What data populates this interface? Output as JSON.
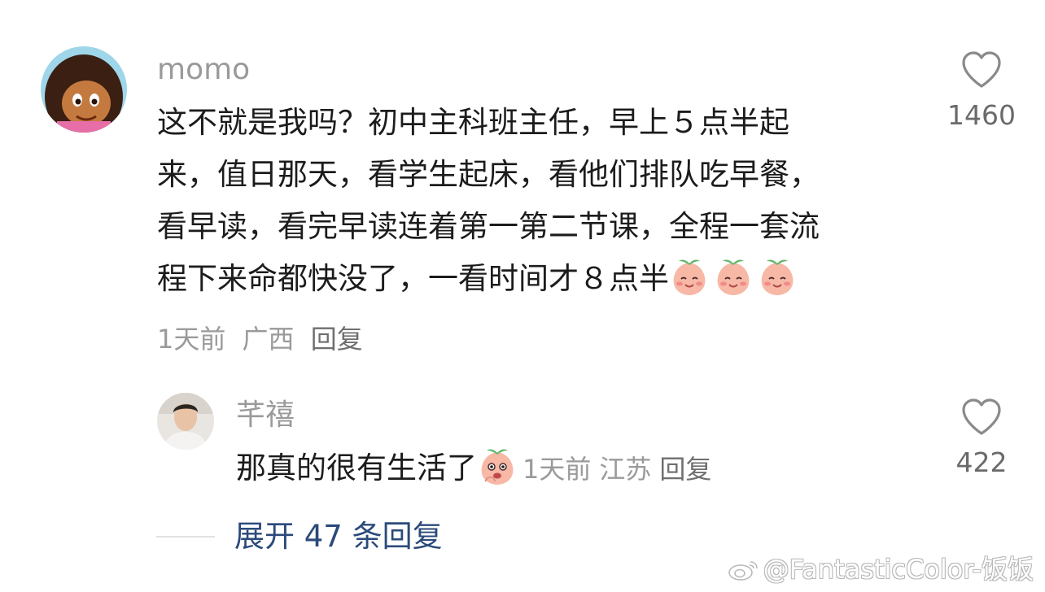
{
  "comment": {
    "username": "momo",
    "content_lines": [
      "这不就是我吗？初中主科班主任，早上５点半起",
      "来，值日那天，看学生起床，看他们排队吃早餐，",
      "看早读，看完早读连着第一第二节课，全程一套流",
      "程下来命都快没了，一看时间才８点半"
    ],
    "emojis": [
      "peach-smile-emoji",
      "peach-smile-emoji",
      "peach-smile-emoji"
    ],
    "time": "1天前",
    "location": "广西",
    "reply_label": "回复",
    "like_count": "1460",
    "avatar_icon": "cartoon-girl-avatar"
  },
  "reply": {
    "username": "芊禧",
    "content": "那真的很有生活了",
    "emoji": "peach-thinking-emoji",
    "time": "1天前",
    "location": "江苏",
    "reply_label": "回复",
    "like_count": "422",
    "avatar_icon": "man-photo-avatar"
  },
  "expand_label": "展开 47 条回复",
  "watermark": "@FantasticColor-饭饭",
  "colors": {
    "username": "#9a9a9a",
    "text": "#1c1c1c",
    "meta": "#9a9a9a",
    "expand": "#2b4a7a"
  }
}
